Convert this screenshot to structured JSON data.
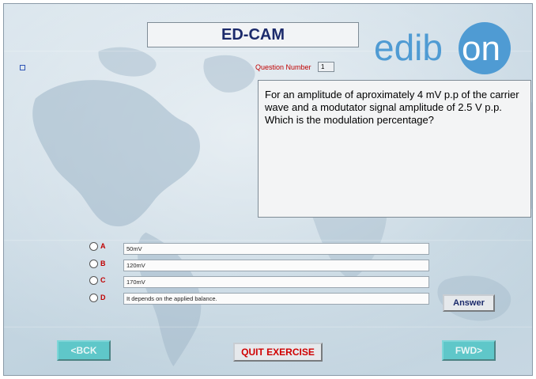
{
  "app": {
    "title": "ED-CAM",
    "logo_text": "edibon"
  },
  "question": {
    "number_label": "Question Number",
    "number_value": "1",
    "text": "For an amplitude of aproximately 4 mV p.p of the carrier wave and a modutator signal amplitude of 2.5 V p.p. Which is the modulation percentage?"
  },
  "options": [
    {
      "letter": "A",
      "value": "50mV"
    },
    {
      "letter": "B",
      "value": "120mV"
    },
    {
      "letter": "C",
      "value": "170mV"
    },
    {
      "letter": "D",
      "value": "It depends on the applied balance."
    }
  ],
  "buttons": {
    "answer": "Answer",
    "back": "<BCK",
    "forward": "FWD>",
    "quit": "QUIT EXERCISE"
  },
  "colors": {
    "title_text": "#1b2a6b",
    "logo": "#4f9bd3",
    "option_letter": "#c00000",
    "nav_button": "#5fc7c9"
  }
}
